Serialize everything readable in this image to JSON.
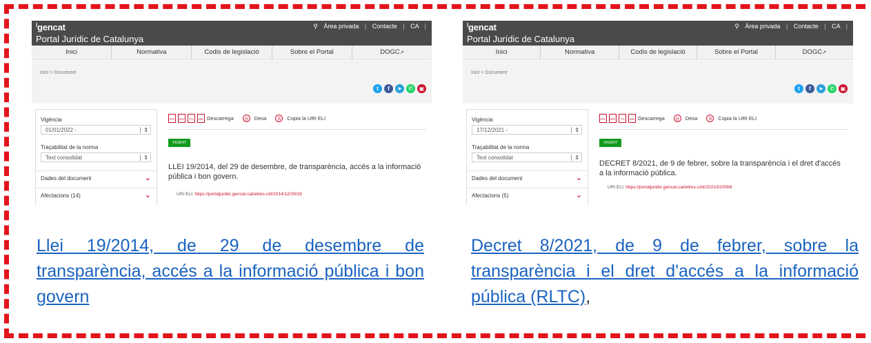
{
  "brand": "gencat",
  "portal_title": "Portal Jurídic de Catalunya",
  "top_links": [
    "Àrea privada",
    "Contacte",
    "CA"
  ],
  "nav": [
    "Inici",
    "Normativa",
    "Codis de legislació",
    "Sobre el Portal",
    "DOGC"
  ],
  "breadcrumb": "Inici > Document",
  "social_icons": [
    "twitter-icon",
    "facebook-icon",
    "telegram-icon",
    "whatsapp-icon",
    "print-icon"
  ],
  "sidebar_labels": {
    "vigencia": "Vigència",
    "tracabilitat": "Traçabilitat de la norma",
    "dades": "Dades del document"
  },
  "actions": {
    "file_types": [
      "PDF",
      "RDF",
      "TTL",
      "XML"
    ],
    "download": "Descarrega",
    "save": "Desa",
    "copy_uri": "Copia la URI ELI"
  },
  "status_badge": "VIGENT",
  "uri_label": "URI ELI:",
  "left": {
    "vigencia_value": "01/01/2022 -",
    "tracabilitat_value": "Text consolidat",
    "afectacions": "Afectacions (14)",
    "doc_title": "LLEI 19/2014, del 29 de desembre, de transparència, accés a la informació pública i bon govern.",
    "uri": "https://portaljuridic.gencat.cat/eli/es-ct/l/2014/12/29/19",
    "caption": "Llei 19/2014, de 29 de desembre de transparència, accés a la informació pública i bon govern"
  },
  "right": {
    "vigencia_value": "17/12/2021 -",
    "tracabilitat_value": "Text consolidat",
    "afectacions": "Afectacions (5)",
    "doc_title": "DECRET 8/2021, de 9 de febrer, sobre la transparència i el dret d'accés a la informació pública.",
    "uri": "https://portaljuridic.gencat.cat/eli/es-ct/d/2021/02/09/8",
    "caption": "Decret 8/2021, de 9 de febrer, sobre la transparència i el dret d'accés a la informació pública (RLTC)",
    "caption_suffix": ","
  },
  "colors": {
    "frame": "#e3141b",
    "link": "#1a63c0",
    "header": "#4a4a4a",
    "badge": "#119a1f",
    "accent": "#c8102e"
  }
}
